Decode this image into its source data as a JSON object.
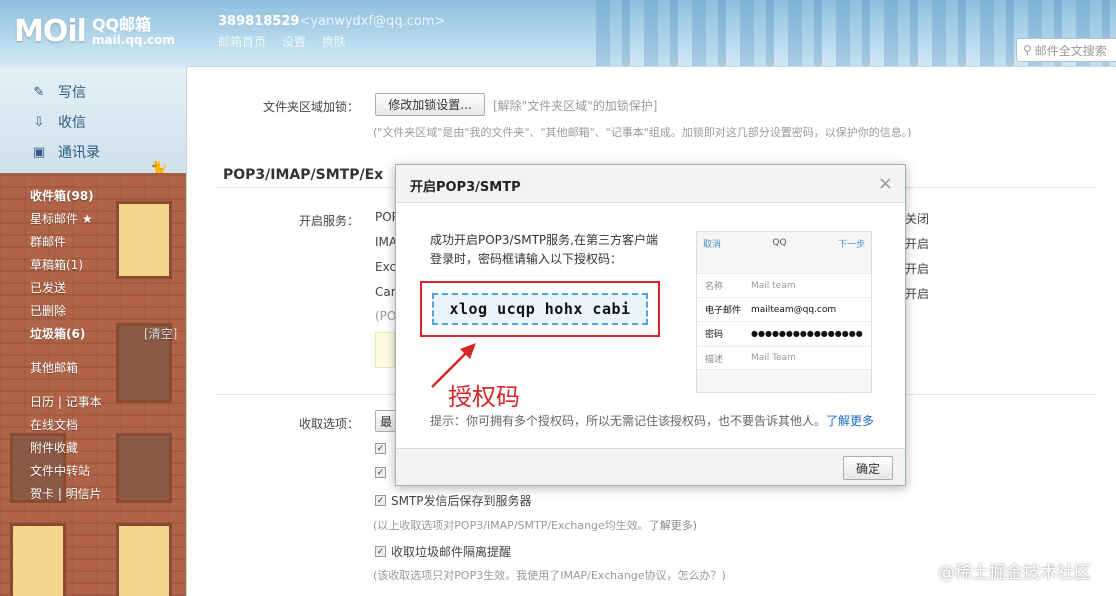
{
  "header": {
    "logo_mark": "MOil",
    "logo_name": "QQ邮箱",
    "logo_domain": "mail.qq.com",
    "account_id": "389818529",
    "account_email": "<yanwydxf@qq.com>",
    "links": [
      "邮箱首页",
      "设置",
      "换肤"
    ],
    "search_placeholder": "邮件全文搜索"
  },
  "sidebar": {
    "compose": "写信",
    "inbox_main": "收信",
    "contacts": "通讯录",
    "folders": [
      {
        "label": "收件箱(98)",
        "bold": true
      },
      {
        "label": "星标邮件 ★",
        "bold": false
      },
      {
        "label": "群邮件",
        "bold": false
      },
      {
        "label": "草稿箱(1)",
        "bold": false
      },
      {
        "label": "已发送",
        "bold": false
      },
      {
        "label": "已删除",
        "bold": false
      },
      {
        "label": "垃圾箱(6)",
        "bold": true
      },
      {
        "label": "其他邮箱",
        "bold": false
      },
      {
        "label": "日历 | 记事本",
        "bold": false
      },
      {
        "label": "在线文档",
        "bold": false
      },
      {
        "label": "附件收藏",
        "bold": false
      },
      {
        "label": "文件中转站",
        "bold": false
      },
      {
        "label": "贺卡 | 明信片",
        "bold": false
      }
    ],
    "clear_label": "[清空]"
  },
  "settings": {
    "folder_lock_label": "文件夹区域加锁：",
    "folder_lock_button": "修改加锁设置...",
    "folder_lock_unlock": "[解除\"文件夹区域\"的加锁保护]",
    "folder_lock_hint": "(\"文件夹区域\"是由\"我的文件夹\"、\"其他邮箱\"、\"记事本\"组成。加锁即对这几部分设置密码，以保护你的信息。)",
    "section_title": "POP3/IMAP/SMTP/Ex",
    "enable_service_label": "开启服务：",
    "service_rows": [
      "POP",
      "IMA",
      "Exc",
      "Car"
    ],
    "service_status": [
      "关闭",
      "开启",
      "开启",
      "开启"
    ],
    "pop_hint": "(PO",
    "receive_options_label": "收取选项：",
    "receive_select": "最",
    "checkbox_smtp": "SMTP发信后保存到服务器",
    "note_effective": "(以上收取选项对POP3/IMAP/SMTP/Exchange均生效。",
    "note_more": "了解更多)",
    "checkbox_spam": "收取垃圾邮件隔离提醒",
    "note_pop3": "(该收取选项只对POP3生效。我使用了IMAP/Exchange协议，怎么办？)"
  },
  "modal": {
    "title": "开启POP3/SMTP",
    "close": "×",
    "desc_line1": "成功开启POP3/SMTP服务,在第三方客户端",
    "desc_line2": "登录时，密码框请输入以下授权码：",
    "auth_code": "xlog ucqp hohx cabi",
    "annotation": "授权码",
    "phone": {
      "cancel": "取消",
      "title": "QQ",
      "next": "下一步",
      "rows": [
        {
          "key": "名称",
          "value": "Mail team",
          "highlight": false
        },
        {
          "key": "电子邮件",
          "value": "mailteam@qq.com",
          "highlight": true
        },
        {
          "key": "密码",
          "value": "●●●●●●●●●●●●●●●●",
          "highlight": true
        },
        {
          "key": "描述",
          "value": "Mail Team",
          "highlight": false
        }
      ]
    },
    "tip": "提示：你可拥有多个授权码，所以无需记住该授权码，也不要告诉其他人。",
    "tip_link": "了解更多",
    "ok_button": "确定"
  },
  "watermark": "@稀土掘金技术社区",
  "colors": {
    "accent_red": "#d9262c",
    "link_blue": "#1a6cc4",
    "code_border": "#4fa7d9"
  }
}
